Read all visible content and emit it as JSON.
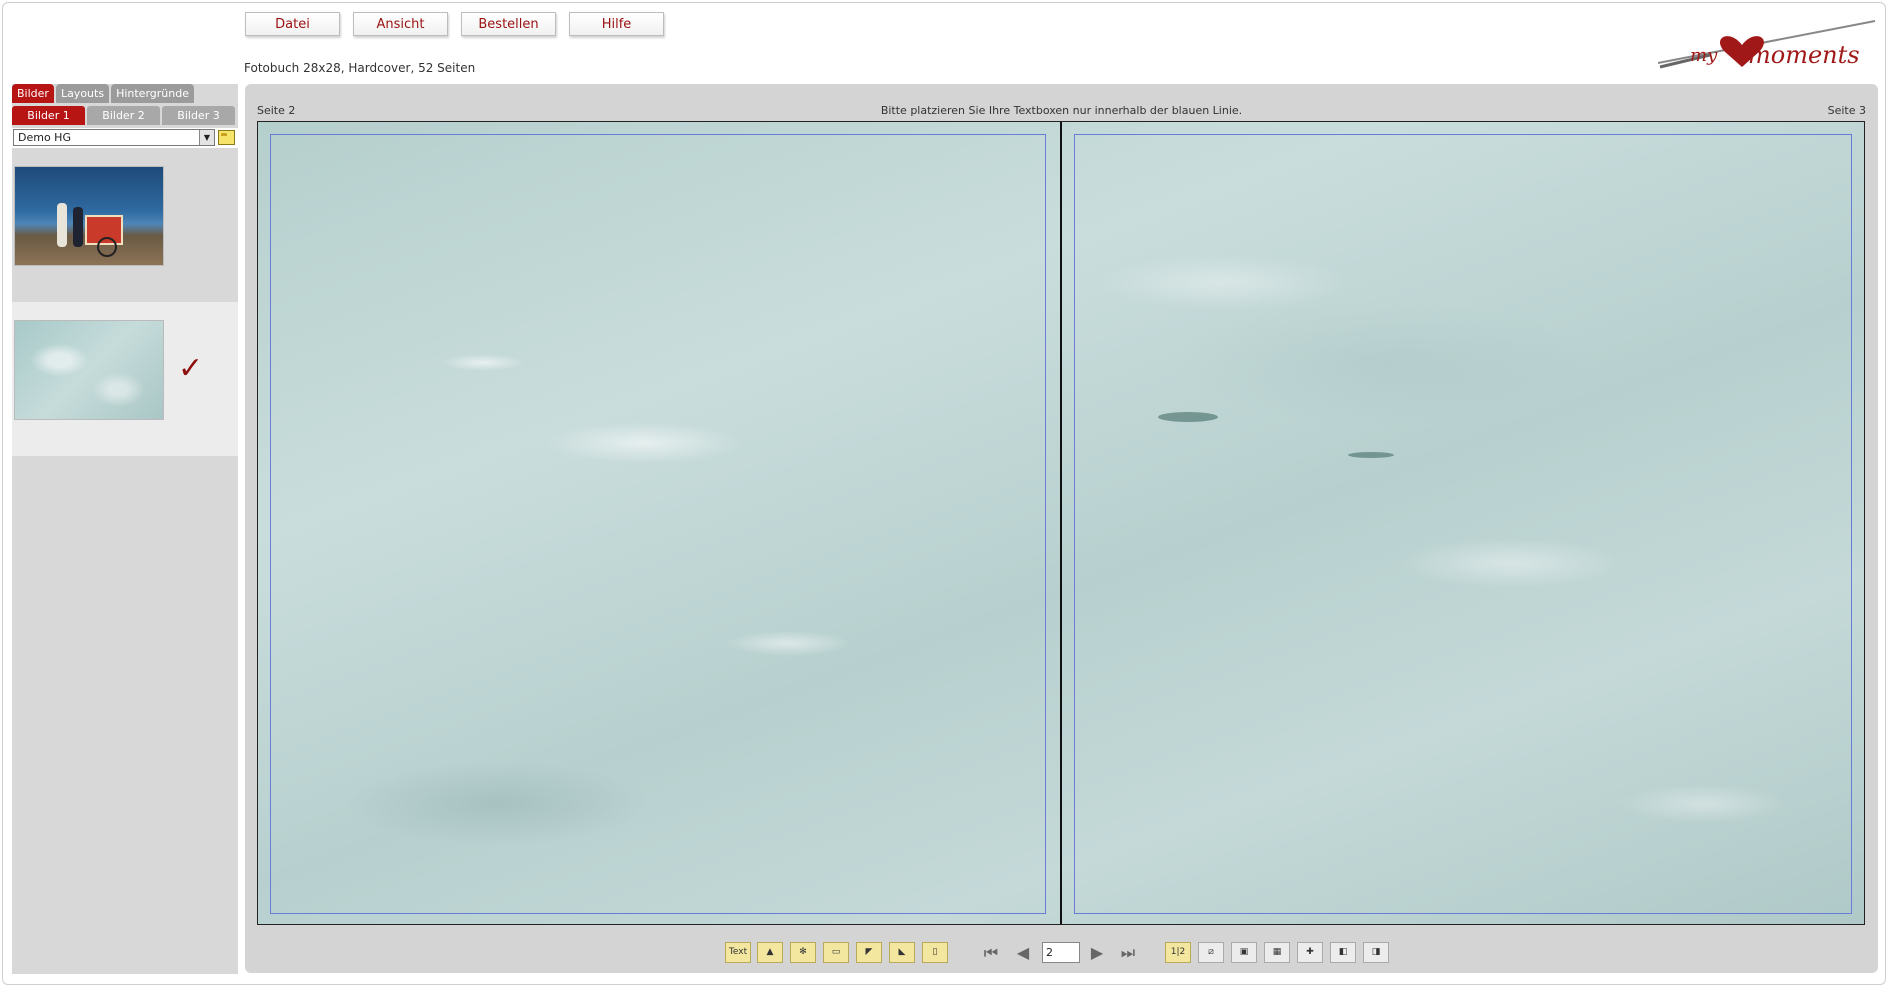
{
  "menu": {
    "items": [
      "Datei",
      "Ansicht",
      "Bestellen",
      "Hilfe"
    ]
  },
  "product_info": "Fotobuch 28x28, Hardcover, 52 Seiten",
  "logo": {
    "text_prefix": "my",
    "text_main": "moments",
    "brand_color": "#a01818"
  },
  "left_panel": {
    "tabs": [
      {
        "label": "Bilder",
        "active": true
      },
      {
        "label": "Layouts",
        "active": false
      },
      {
        "label": "Hintergründe",
        "active": false
      }
    ],
    "subtabs": [
      {
        "label": "Bilder 1",
        "active": true
      },
      {
        "label": "Bilder 2",
        "active": false
      },
      {
        "label": "Bilder 3",
        "active": false
      }
    ],
    "folder_select": {
      "value": "Demo HG"
    },
    "thumbnails": [
      {
        "name": "beach-photo",
        "selected": false
      },
      {
        "name": "water-photo",
        "selected": true
      }
    ],
    "check_mark": "✓"
  },
  "canvas": {
    "left_page_label": "Seite 2",
    "right_page_label": "Seite 3",
    "hint": "Bitte platzieren Sie Ihre Textboxen nur innerhalb der blauen Linie."
  },
  "toolbar": {
    "text_button": "Text",
    "page_number": "2",
    "page_view_label": "1|2"
  },
  "colors": {
    "accent": "#b71414",
    "menu_text": "#9a1111",
    "safe_line": "#6a7dd6",
    "panel_bg": "#d8d8d8"
  }
}
